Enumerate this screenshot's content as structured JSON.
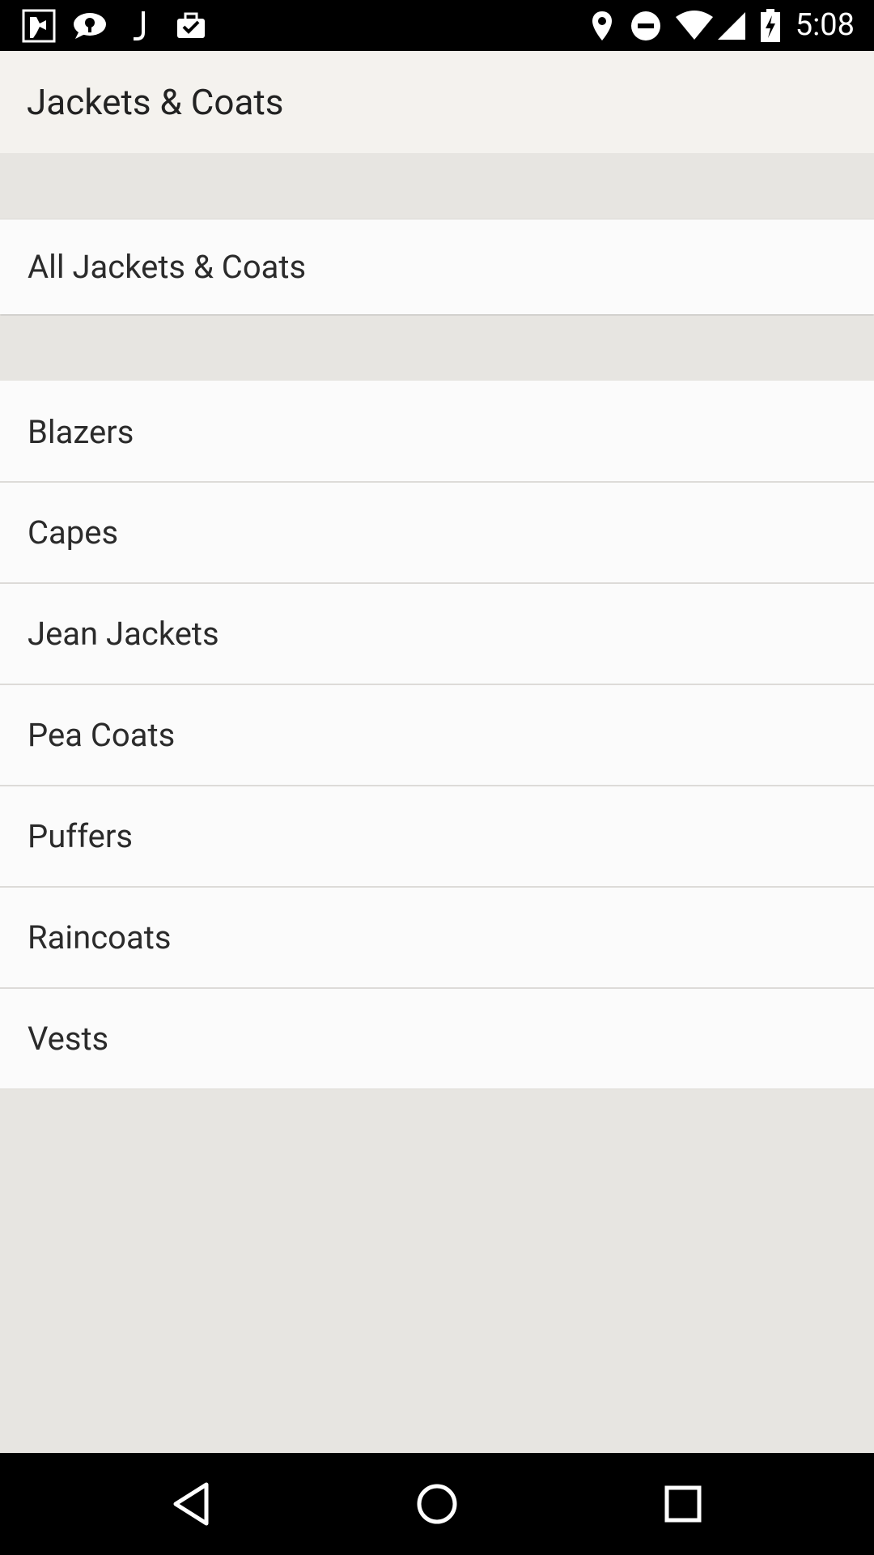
{
  "status_bar": {
    "time": "5:08",
    "left_icons": [
      "media-icon",
      "chat-icon",
      "j-app-icon",
      "briefcase-check-icon"
    ],
    "right_icons": [
      "location-pin-icon",
      "do-not-disturb-icon",
      "wifi-icon",
      "signal-icon",
      "battery-charging-icon"
    ]
  },
  "app_bar": {
    "title": "Jackets & Coats"
  },
  "featured": {
    "label": "All Jackets & Coats"
  },
  "categories": [
    {
      "label": "Blazers"
    },
    {
      "label": "Capes"
    },
    {
      "label": "Jean Jackets"
    },
    {
      "label": "Pea Coats"
    },
    {
      "label": "Puffers"
    },
    {
      "label": "Raincoats"
    },
    {
      "label": "Vests"
    }
  ],
  "nav_bar": {
    "buttons": [
      "back-icon",
      "home-icon",
      "recents-icon"
    ]
  }
}
